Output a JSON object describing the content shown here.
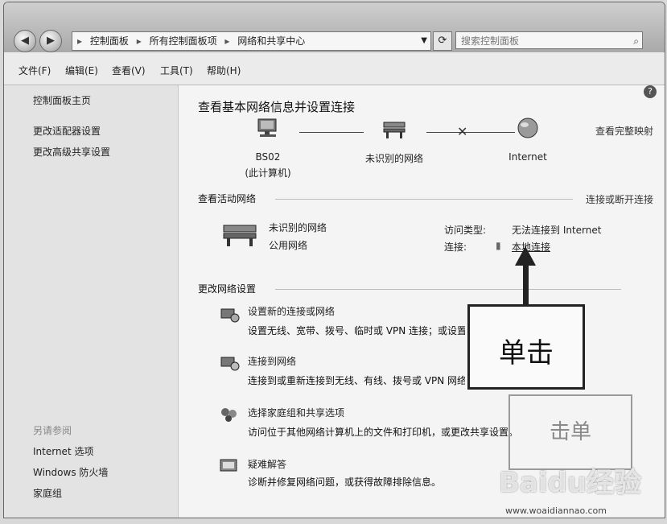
{
  "breadcrumb": [
    "控制面板",
    "所有控制面板项",
    "网络和共享中心"
  ],
  "search": {
    "placeholder": "搜索控制面板"
  },
  "menu": [
    "文件(F)",
    "编辑(E)",
    "查看(V)",
    "工具(T)",
    "帮助(H)"
  ],
  "sidebar": {
    "home": "控制面板主页",
    "links": [
      "更改适配器设置",
      "更改高级共享设置"
    ],
    "see_also_title": "另请参阅",
    "see_also": [
      "Internet 选项",
      "Windows 防火墙",
      "家庭组"
    ]
  },
  "main": {
    "title": "查看基本网络信息并设置连接",
    "full_map_link": "查看完整映射",
    "map": {
      "computer_name": "BS02",
      "computer_sub": "(此计算机)",
      "network": "未识别的网络",
      "internet": "Internet"
    },
    "active_section": {
      "title": "查看活动网络",
      "connect_link": "连接或断开连接",
      "network_name": "未识别的网络",
      "network_type": "公用网络",
      "access_label": "访问类型:",
      "access_value": "无法连接到 Internet",
      "connection_label": "连接:",
      "connection_value": "本地连接"
    },
    "change_section": {
      "title": "更改网络设置",
      "tasks": [
        {
          "title": "设置新的连接或网络",
          "desc": "设置无线、宽带、拨号、临时或 VPN 连接；或设置路由器或访问点。"
        },
        {
          "title": "连接到网络",
          "desc": "连接到或重新连接到无线、有线、拨号或 VPN 网络连接。"
        },
        {
          "title": "选择家庭组和共享选项",
          "desc": "访问位于其他网络计算机上的文件和打印机，或更改共享设置。"
        },
        {
          "title": "疑难解答",
          "desc": "诊断并修复网络问题，或获得故障排除信息。"
        }
      ]
    }
  },
  "annotation": {
    "callout": "单击",
    "ghost": "击单"
  },
  "watermark": {
    "main": "Baidu经验",
    "sub": "www.woaidiannao.com"
  }
}
